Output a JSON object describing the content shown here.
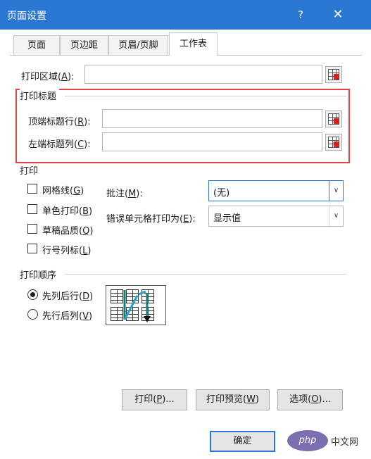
{
  "window": {
    "title": "页面设置",
    "help": "?",
    "close": "✕"
  },
  "tabs": [
    {
      "label": "页面"
    },
    {
      "label": "页边距"
    },
    {
      "label": "页眉/页脚"
    },
    {
      "label": "工作表",
      "active": true
    }
  ],
  "print_area": {
    "label": "打印区域(",
    "key": "A",
    "suffix": "):",
    "value": ""
  },
  "print_titles": {
    "heading": "打印标题",
    "top_rows": {
      "label": "顶端标题行(",
      "key": "R",
      "suffix": "):",
      "value": ""
    },
    "left_cols": {
      "label": "左端标题列(",
      "key": "C",
      "suffix": "):",
      "value": ""
    }
  },
  "print": {
    "heading": "打印",
    "gridlines": {
      "label": "网格线(",
      "key": "G",
      "suffix": ")",
      "checked": false
    },
    "black_white": {
      "label": "单色打印(",
      "key": "B",
      "suffix": ")",
      "checked": false
    },
    "draft": {
      "label": "草稿品质(",
      "key": "Q",
      "suffix": ")",
      "checked": false
    },
    "row_col_headings": {
      "label": "行号列标(",
      "key": "L",
      "suffix": ")",
      "checked": false
    },
    "comments": {
      "label": "批注(",
      "key": "M",
      "suffix": "):",
      "value": "(无)"
    },
    "cell_errors": {
      "label": "错误单元格打印为(",
      "key": "E",
      "suffix": "):",
      "value": "显示值"
    }
  },
  "page_order": {
    "heading": "打印顺序",
    "down_then_over": {
      "label": "先列后行(",
      "key": "D",
      "suffix": ")",
      "checked": true
    },
    "over_then_down": {
      "label": "先行后列(",
      "key": "V",
      "suffix": ")",
      "checked": false
    }
  },
  "buttons": {
    "print": {
      "label": "打印(",
      "key": "P",
      "suffix": ")..."
    },
    "preview": {
      "label": "打印预览(",
      "key": "W",
      "suffix": ")"
    },
    "options": {
      "label": "选项(",
      "key": "O",
      "suffix": ")..."
    },
    "ok": {
      "label": "确定"
    }
  },
  "watermark": {
    "logo": "php",
    "site": "中文网"
  },
  "colors": {
    "titlebar": "#2b78d4",
    "highlight_frame": "#e24545",
    "focus": "#2b78d4"
  }
}
